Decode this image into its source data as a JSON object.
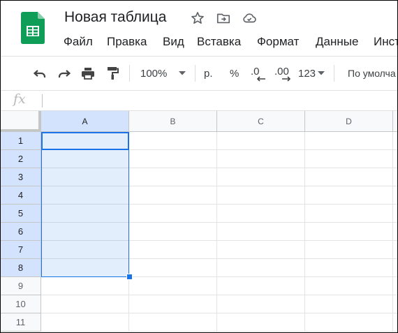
{
  "doc": {
    "title": "Новая таблица",
    "icons": [
      "star-icon",
      "move-to-folder-icon",
      "cloud-saved-icon"
    ]
  },
  "menu": [
    "Файл",
    "Правка",
    "Вид",
    "Вставка",
    "Формат",
    "Данные",
    "Инст"
  ],
  "toolbar": {
    "zoom": "100%",
    "currency": "р.",
    "percent": "%",
    "decrease_decimals": ".0",
    "increase_decimals": ".00",
    "number_format": "123",
    "font": "По умолча"
  },
  "formula": {
    "fx_label": "fx",
    "value": ""
  },
  "grid": {
    "columns": [
      "A",
      "B",
      "C",
      "D"
    ],
    "rows": [
      "1",
      "2",
      "3",
      "4",
      "5",
      "6",
      "7",
      "8",
      "9",
      "10",
      "11"
    ],
    "selected_column": "A",
    "selected_rows": [
      "1",
      "2",
      "3",
      "4",
      "5",
      "6",
      "7",
      "8"
    ],
    "accent_color": "#1a73e8"
  }
}
